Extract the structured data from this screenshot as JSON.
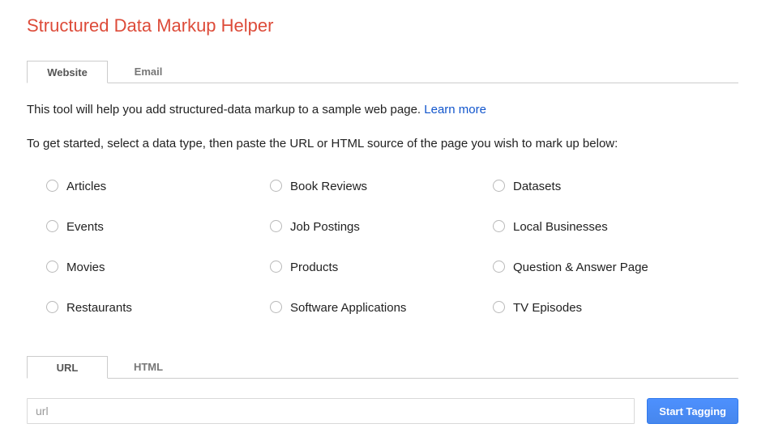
{
  "page": {
    "title": "Structured Data Markup Helper",
    "intro_text": "This tool will help you add structured-data markup to a sample web page. ",
    "learn_more_label": "Learn more",
    "instruction_text": "To get started, select a data type, then paste the URL or HTML source of the page you wish to mark up below:"
  },
  "top_tabs": [
    {
      "label": "Website",
      "active": true
    },
    {
      "label": "Email",
      "active": false
    }
  ],
  "data_types": [
    "Articles",
    "Book Reviews",
    "Datasets",
    "Events",
    "Job Postings",
    "Local Businesses",
    "Movies",
    "Products",
    "Question & Answer Page",
    "Restaurants",
    "Software Applications",
    "TV Episodes"
  ],
  "source_tabs": [
    {
      "label": "URL",
      "active": true
    },
    {
      "label": "HTML",
      "active": false
    }
  ],
  "url_input": {
    "value": "",
    "placeholder": "url"
  },
  "start_button_label": "Start Tagging",
  "colors": {
    "title_red": "#dd4b39",
    "link_blue": "#1155cc",
    "button_blue": "#4d90fe",
    "button_border": "#3079ed",
    "tab_border": "#cccccc"
  }
}
